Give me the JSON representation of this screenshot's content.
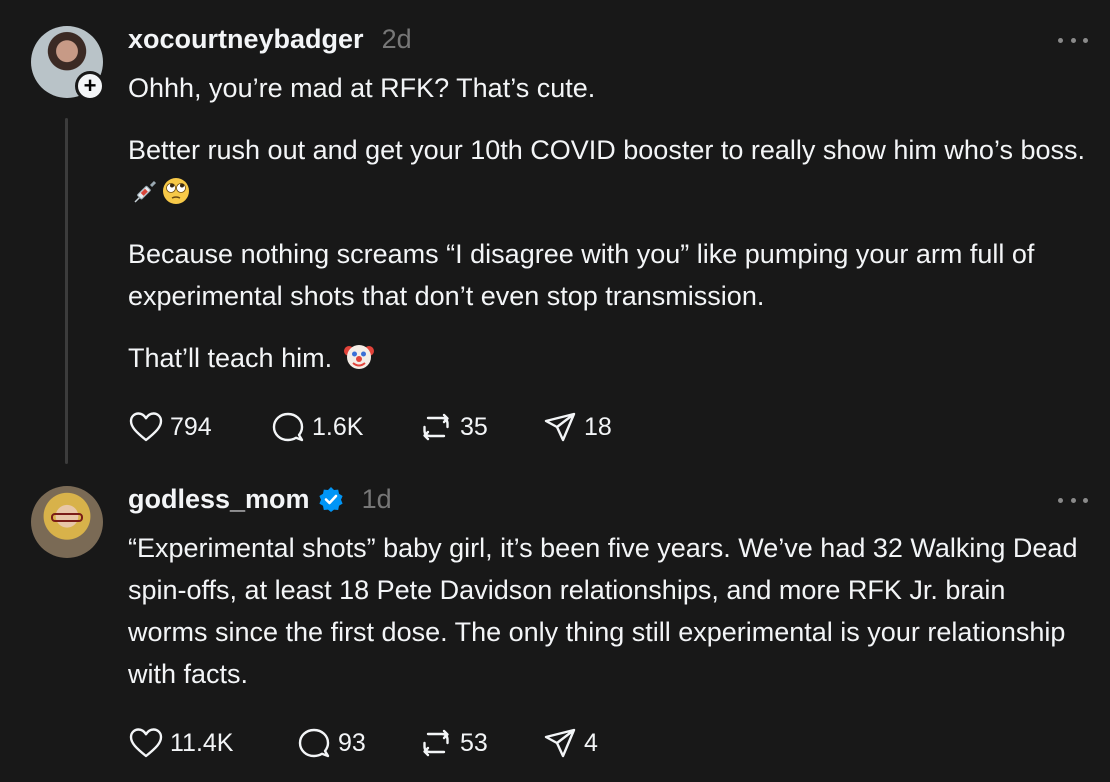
{
  "posts": [
    {
      "username": "xocourtneybadger",
      "time": "2d",
      "paragraphs": [
        "Ohhh, you’re mad at RFK? That’s cute.",
        "Better rush out and get your 10th COVID booster to really show him who’s boss.",
        "Because nothing screams “I disagree with you” like pumping your arm full of experimental shots that don’t even stop transmission.",
        "That’ll teach him."
      ],
      "emojis": [
        "syringe-icon",
        "eye-roll-face-icon",
        "clown-face-icon"
      ],
      "likes": "794",
      "replies": "1.6K",
      "reposts": "35",
      "shares": "18"
    },
    {
      "username": "godless_mom",
      "verified": true,
      "time": "1d",
      "paragraphs": [
        "“Experimental shots” baby girl, it’s been five years. We’ve had 32 Walking Dead spin-offs, at least 18 Pete Davidson relationships, and more RFK Jr. brain worms since the first dose. The only thing still experimental is your relationship with facts."
      ],
      "likes": "11.4K",
      "replies": "93",
      "reposts": "53",
      "shares": "4"
    }
  ],
  "colors": {
    "background": "#181818",
    "text": "#f3f5f7",
    "muted": "#777777",
    "verified": "#0095f6"
  }
}
